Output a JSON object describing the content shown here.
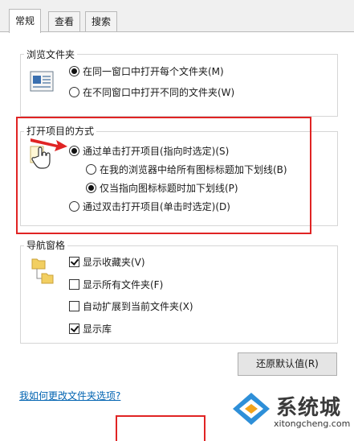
{
  "tabs": [
    "常规",
    "查看",
    "搜索"
  ],
  "browse_group": {
    "title": "浏览文件夹",
    "options": [
      {
        "label": "在同一窗口中打开每个文件夹(M)",
        "checked": true
      },
      {
        "label": "在不同窗口中打开不同的文件夹(W)",
        "checked": false
      }
    ]
  },
  "open_group": {
    "title": "打开项目的方式",
    "options": [
      {
        "label": "通过单击打开项目(指向时选定)(S)",
        "checked": true
      },
      {
        "label": "在我的浏览器中给所有图标标题加下划线(B)",
        "checked": false
      },
      {
        "label": "仅当指向图标标题时加下划线(P)",
        "checked": true
      },
      {
        "label": "通过双击打开项目(单击时选定)(D)",
        "checked": false
      }
    ]
  },
  "nav_group": {
    "title": "导航窗格",
    "options": [
      {
        "label": "显示收藏夹(V)",
        "checked": true
      },
      {
        "label": "显示所有文件夹(F)",
        "checked": false
      },
      {
        "label": "自动扩展到当前文件夹(X)",
        "checked": false
      },
      {
        "label": "显示库",
        "checked": true
      }
    ]
  },
  "restore_button": "还原默认值(R)",
  "help_link": "我如何更改文件夹选项?",
  "watermark": {
    "title": "系统城",
    "url": "xitongcheng.com"
  },
  "colors": {
    "highlight": "#e02424",
    "arrow": "#e02424"
  }
}
